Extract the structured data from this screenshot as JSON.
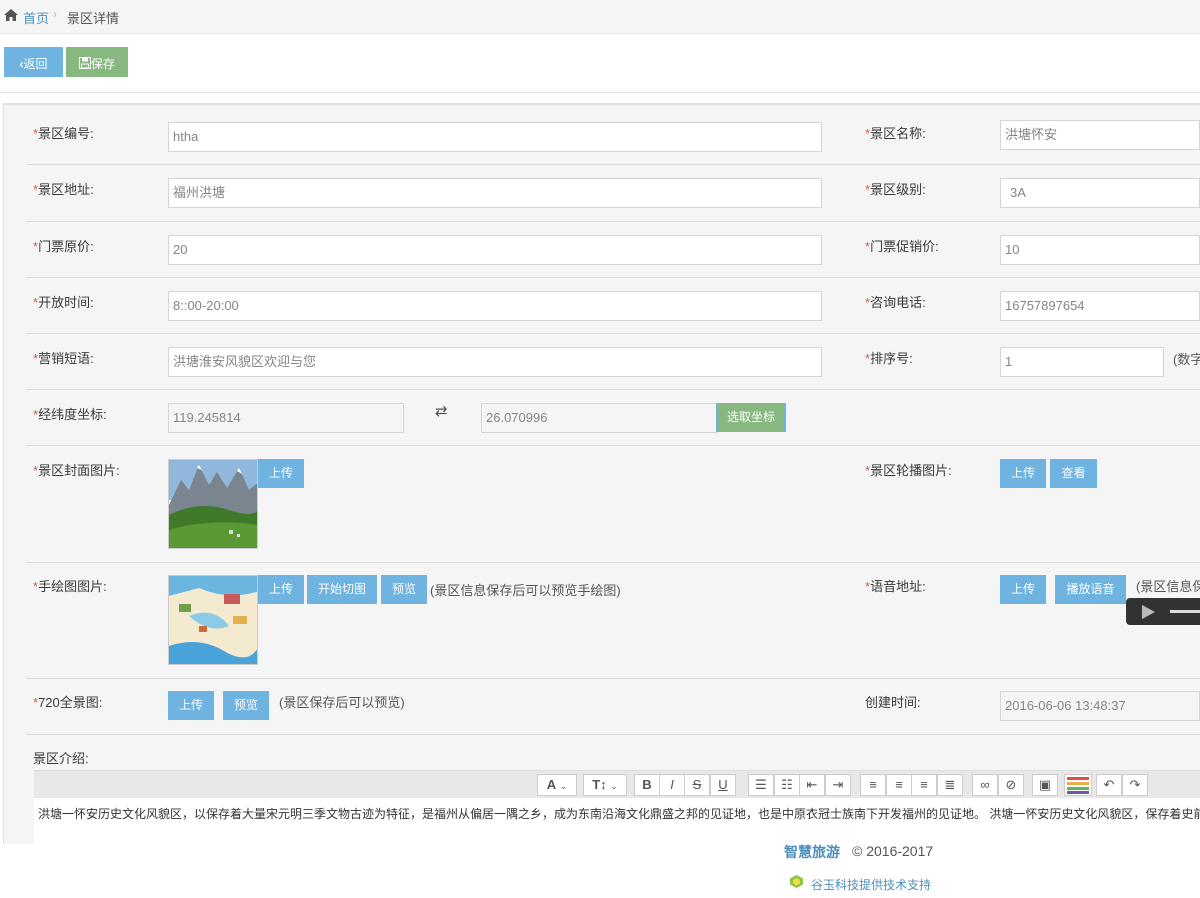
{
  "breadcrumb": {
    "home": "首页",
    "current": "景区详情"
  },
  "toolbar": {
    "back_label": "返回",
    "save_label": "保存"
  },
  "form": {
    "code": {
      "label": "景区编号:",
      "value": "htha"
    },
    "name": {
      "label": "景区名称:",
      "value": "洪塘怀安"
    },
    "address": {
      "label": "景区地址:",
      "value": "福州洪塘"
    },
    "level": {
      "label": "景区级别:",
      "value": "3A"
    },
    "price": {
      "label": "门票原价:",
      "value": "20"
    },
    "promo_price": {
      "label": "门票促销价:",
      "value": "10"
    },
    "hours": {
      "label": "开放时间:",
      "value": "8::00-20:00"
    },
    "phone": {
      "label": "咨询电话:",
      "value": "16757897654"
    },
    "slogan": {
      "label": "营销短语:",
      "value": "洪塘淮安风貌区欢迎与您"
    },
    "sort": {
      "label": "排序号:",
      "value": "1",
      "hint": "(数字"
    },
    "coords": {
      "label": "经纬度坐标:",
      "lng": "119.245814",
      "swap_icon": "⇄",
      "lat": "26.070996",
      "pick_label": "选取坐标"
    },
    "cover": {
      "label": "景区封面图片:",
      "upload_label": "上传"
    },
    "carousel": {
      "label": "景区轮播图片:",
      "upload_label": "上传",
      "view_label": "查看"
    },
    "handdrawn": {
      "label": "手绘图图片:",
      "upload_label": "上传",
      "cut_label": "开始切图",
      "preview_label": "预览",
      "hint": "(景区信息保存后可以预览手绘图)"
    },
    "voice": {
      "label": "语音地址:",
      "upload_label": "上传",
      "play_label": "播放语音",
      "hint": "(景区信息保"
    },
    "pano": {
      "label": "720全景图:",
      "upload_label": "上传",
      "preview_label": "预览",
      "hint": "(景区保存后可以预览)"
    },
    "created": {
      "label": "创建时间:",
      "value": "2016-06-06 13:48:37"
    },
    "intro": {
      "label": "景区介绍:",
      "text": "洪塘一怀安历史文化风貌区，以保存着大量宋元明三季文物古迹为特征，是福州从偏居一隅之乡，成为东南沿海文化鼎盛之邦的见证地，也是中原衣冠士族南下开发福州的见证地。 洪塘一怀安历史文化风貌区，保存着史前"
    }
  },
  "required_mark": "*",
  "editor_tools": [
    "A",
    "T↕",
    "B",
    "I",
    "S",
    "U"
  ],
  "footer": {
    "brand": "智慧旅游",
    "copy": "© 2016-2017",
    "support": "谷玉科技提供技术支持"
  },
  "colors": {
    "primary": "#6fb3e0",
    "success": "#87b87f",
    "required": "#d15b47",
    "link": "#4c8fbd"
  }
}
